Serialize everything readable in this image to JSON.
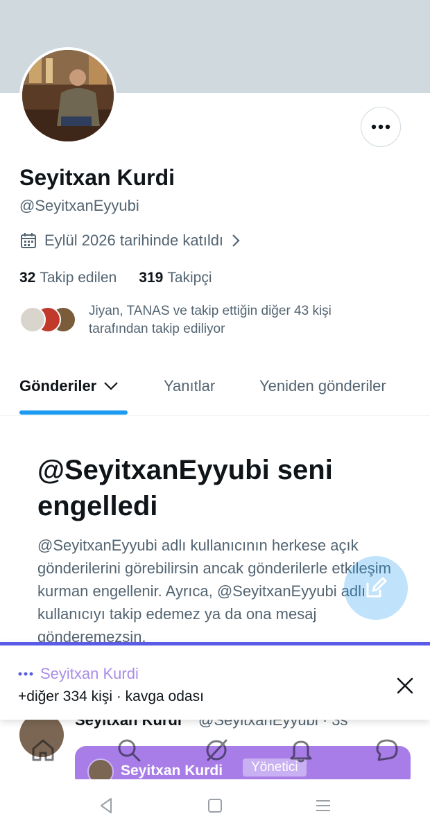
{
  "profile": {
    "name": "Seyitxan Kurdi",
    "handle": "@SeyitxanEyyubi",
    "joined": "Eylül 2026 tarihinde katıldı",
    "following_count": "32",
    "following_label": "Takip edilen",
    "followers_count": "319",
    "followers_label": "Takipçi",
    "followed_by_text": "Jiyan, TANAS ve takip ettiğin diğer 43 kişi tarafından takip ediliyor"
  },
  "icons": {
    "more": "more-horizontal-icon",
    "calendar": "calendar-icon",
    "chevron": "chevron-right-icon",
    "compose": "compose-icon",
    "close": "close-icon"
  },
  "tabs": [
    {
      "label": "Gönderiler",
      "active": true
    },
    {
      "label": "Yanıtlar",
      "active": false
    },
    {
      "label": "Yeniden gönderiler",
      "active": false
    }
  ],
  "blocked": {
    "title": "@SeyitxanEyyubi seni engelledi",
    "description": "@SeyitxanEyyubi adlı kullanıcının herkese açık gönderilerini görebilirsin ancak gönderilerle etkileşim kurman engellenir. Ayrıca, @SeyitxanEyyubi adlı kullanıcıyı takip edemez ya da ona mesaj gönderemezsin."
  },
  "space": {
    "host": "Seyitxan Kurdi",
    "subtitle": "+diğer 334 kişi · kavga odası"
  },
  "tweet": {
    "name": "Seyitxan Kurdi",
    "meta": "@SeyitxanEyyubi · 3s",
    "card_name": "Seyitxan Kurdi",
    "card_role": "Yönetici"
  },
  "colors": {
    "accent": "#1d9bf0",
    "space_purple": "#a87de8",
    "space_border": "#5a5ce8",
    "banner": "#cfd9de"
  }
}
